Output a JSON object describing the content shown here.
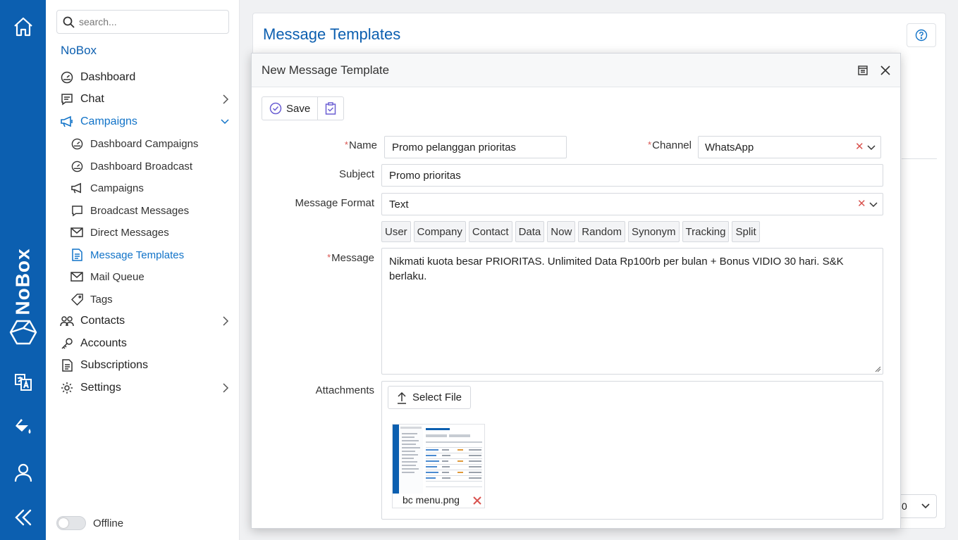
{
  "rail": {
    "brand": "NoBox",
    "icons": [
      "home-icon",
      "translate-icon",
      "paint-bucket-icon",
      "user-icon",
      "collapse-icon"
    ]
  },
  "sidebar": {
    "search_placeholder": "search...",
    "org_name": "NoBox",
    "items": [
      {
        "label": "Dashboard",
        "icon": "gauge-icon"
      },
      {
        "label": "Chat",
        "icon": "chat-icon"
      },
      {
        "label": "Campaigns",
        "icon": "megaphone-icon"
      },
      {
        "label": "Contacts",
        "icon": "contacts-icon"
      },
      {
        "label": "Accounts",
        "icon": "key-icon"
      },
      {
        "label": "Subscriptions",
        "icon": "document-icon"
      },
      {
        "label": "Settings",
        "icon": "gear-icon"
      }
    ],
    "campaign_items": [
      {
        "label": "Dashboard Campaigns"
      },
      {
        "label": "Dashboard Broadcast"
      },
      {
        "label": "Campaigns"
      },
      {
        "label": "Broadcast Messages"
      },
      {
        "label": "Direct Messages"
      },
      {
        "label": "Message Templates"
      },
      {
        "label": "Mail Queue"
      },
      {
        "label": "Tags"
      }
    ],
    "status_label": "Offline"
  },
  "page": {
    "title": "Message Templates",
    "bg_select_value": "0"
  },
  "modal": {
    "title": "New Message Template",
    "save_label": "Save",
    "form": {
      "name_label": "Name",
      "name_value": "Promo pelanggan prioritas",
      "channel_label": "Channel",
      "channel_value": "WhatsApp",
      "subject_label": "Subject",
      "subject_value": "Promo prioritas",
      "format_label": "Message Format",
      "format_value": "Text",
      "message_label": "Message",
      "message_value": "Nikmati kuota besar PRIORITAS. Unlimited Data Rp100rb per bulan + Bonus VIDIO 30 hari. S&K berlaku.",
      "attachments_label": "Attachments",
      "select_file_label": "Select File",
      "attachment_name": "bc menu.png"
    },
    "placeholder_tags": [
      "User",
      "Company",
      "Contact",
      "Data",
      "Now",
      "Random",
      "Synonym",
      "Tracking",
      "Split"
    ]
  },
  "colors": {
    "brand": "#0c5fb0",
    "link": "#1173c8",
    "danger": "#d9534f"
  }
}
